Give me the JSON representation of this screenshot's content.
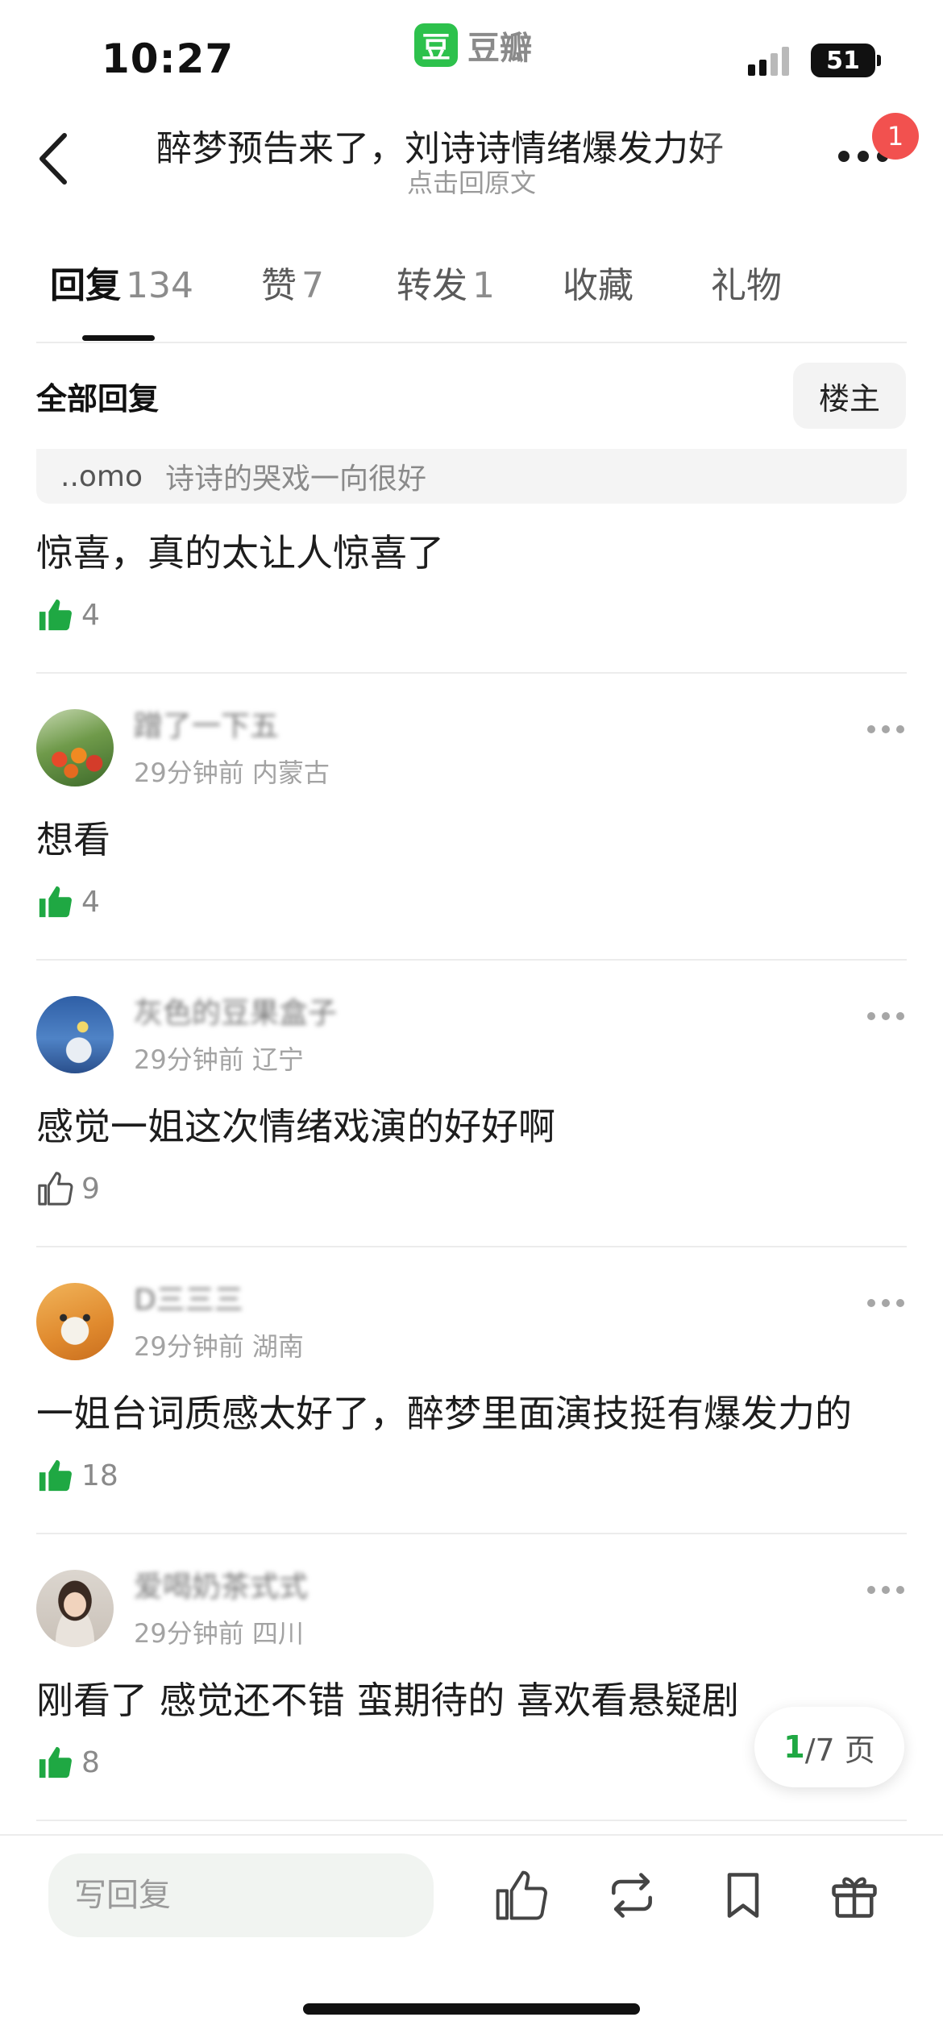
{
  "status_bar": {
    "time": "10:27",
    "battery": "51"
  },
  "app": {
    "logo_char": "豆",
    "name": "豆瓣"
  },
  "header": {
    "title": "醉梦预告来了，刘诗诗情绪爆发力好",
    "subtitle": "点击回原文",
    "notification_count": "1"
  },
  "tabs": [
    {
      "label": "回复",
      "count": "134"
    },
    {
      "label": "赞",
      "count": "7"
    },
    {
      "label": "转发",
      "count": "1"
    },
    {
      "label": "收藏",
      "count": ""
    },
    {
      "label": "礼物",
      "count": ""
    }
  ],
  "section": {
    "title": "全部回复",
    "owner_button": "楼主"
  },
  "first_reply": {
    "quote_user": "..omo",
    "quote_text": "诗诗的哭戏一向很好",
    "text": "惊喜，真的太让人惊喜了",
    "likes": "4"
  },
  "comments": [
    {
      "username": "蹭了一下五",
      "time": "29分钟前",
      "location": "内蒙古",
      "text": "想看",
      "likes": "4",
      "liked": true
    },
    {
      "username": "灰色的豆果盒子",
      "time": "29分钟前",
      "location": "辽宁",
      "text": "感觉一姐这次情绪戏演的好好啊",
      "likes": "9",
      "liked": false
    },
    {
      "username": "D三三三",
      "time": "29分钟前",
      "location": "湖南",
      "text": "一姐台词质感太好了，醉梦里面演技挺有爆发力的",
      "likes": "18",
      "liked": true
    },
    {
      "username": "爱喝奶茶式式",
      "time": "29分钟前",
      "location": "四川",
      "text": "刚看了 感觉还不错 蛮期待的 喜欢看悬疑剧",
      "likes": "8",
      "liked": true
    }
  ],
  "pagination": {
    "current": "1",
    "total": "/7 页"
  },
  "bottom_bar": {
    "reply_placeholder": "写回复"
  },
  "colors": {
    "accent_green": "#2dc14c",
    "like_green": "#1fa843",
    "badge_red": "#f2514f"
  },
  "icons": {
    "back": "chevron-left-icon",
    "more": "ellipsis-icon",
    "like": "thumbs-up-icon",
    "repost": "repost-icon",
    "bookmark": "bookmark-icon",
    "gift": "gift-icon"
  }
}
